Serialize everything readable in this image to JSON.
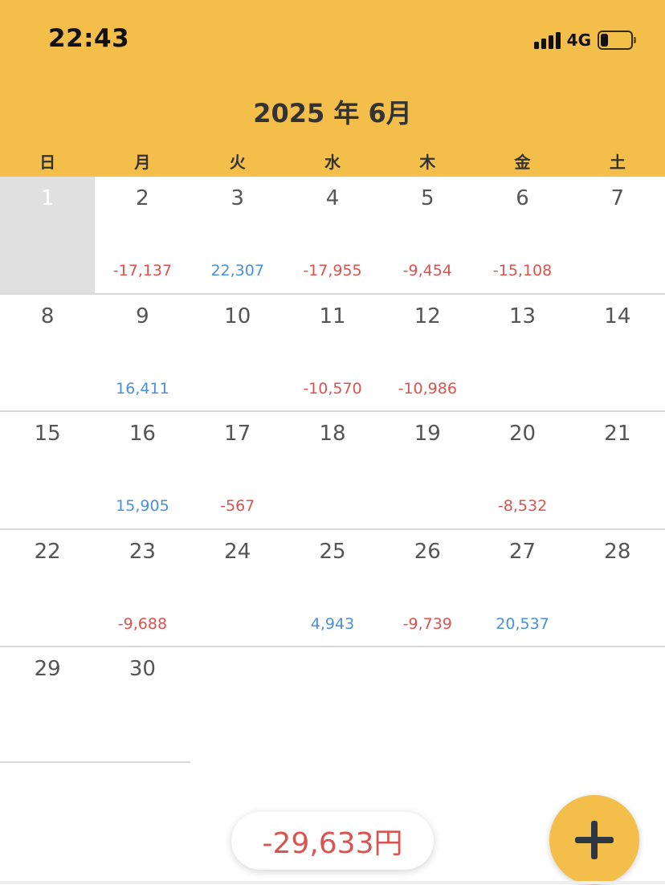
{
  "status_bar": {
    "time": "22:43",
    "network": "4G",
    "signal_bars": 4,
    "battery_level": 0.25
  },
  "header": {
    "title": "2025 年 6月"
  },
  "weekdays": [
    "日",
    "月",
    "火",
    "水",
    "木",
    "金",
    "土"
  ],
  "colors": {
    "header_bg": "#F4BE4B",
    "income": "#4A90D9",
    "expense": "#D9534F",
    "today_bg": "#E0E0E0"
  },
  "weeks": [
    [
      {
        "day": "1",
        "amount": "",
        "type": "",
        "today": true
      },
      {
        "day": "2",
        "amount": "-17,137",
        "type": "expense"
      },
      {
        "day": "3",
        "amount": "22,307",
        "type": "income"
      },
      {
        "day": "4",
        "amount": "-17,955",
        "type": "expense"
      },
      {
        "day": "5",
        "amount": "-9,454",
        "type": "expense"
      },
      {
        "day": "6",
        "amount": "-15,108",
        "type": "expense"
      },
      {
        "day": "7",
        "amount": "",
        "type": ""
      }
    ],
    [
      {
        "day": "8",
        "amount": "",
        "type": ""
      },
      {
        "day": "9",
        "amount": "16,411",
        "type": "income"
      },
      {
        "day": "10",
        "amount": "",
        "type": ""
      },
      {
        "day": "11",
        "amount": "-10,570",
        "type": "expense"
      },
      {
        "day": "12",
        "amount": "-10,986",
        "type": "expense"
      },
      {
        "day": "13",
        "amount": "",
        "type": ""
      },
      {
        "day": "14",
        "amount": "",
        "type": ""
      }
    ],
    [
      {
        "day": "15",
        "amount": "",
        "type": ""
      },
      {
        "day": "16",
        "amount": "15,905",
        "type": "income"
      },
      {
        "day": "17",
        "amount": "-567",
        "type": "expense"
      },
      {
        "day": "18",
        "amount": "",
        "type": ""
      },
      {
        "day": "19",
        "amount": "",
        "type": ""
      },
      {
        "day": "20",
        "amount": "-8,532",
        "type": "expense"
      },
      {
        "day": "21",
        "amount": "",
        "type": ""
      }
    ],
    [
      {
        "day": "22",
        "amount": "",
        "type": ""
      },
      {
        "day": "23",
        "amount": "-9,688",
        "type": "expense"
      },
      {
        "day": "24",
        "amount": "",
        "type": ""
      },
      {
        "day": "25",
        "amount": "4,943",
        "type": "income"
      },
      {
        "day": "26",
        "amount": "-9,739",
        "type": "expense"
      },
      {
        "day": "27",
        "amount": "20,537",
        "type": "income"
      },
      {
        "day": "28",
        "amount": "",
        "type": ""
      }
    ],
    [
      {
        "day": "29",
        "amount": "",
        "type": ""
      },
      {
        "day": "30",
        "amount": "",
        "type": ""
      },
      {
        "day": "",
        "amount": "",
        "type": ""
      },
      {
        "day": "",
        "amount": "",
        "type": ""
      },
      {
        "day": "",
        "amount": "",
        "type": ""
      },
      {
        "day": "",
        "amount": "",
        "type": ""
      },
      {
        "day": "",
        "amount": "",
        "type": ""
      }
    ]
  ],
  "total": {
    "label": "-29,633円"
  },
  "fab": {
    "icon": "plus-icon"
  }
}
